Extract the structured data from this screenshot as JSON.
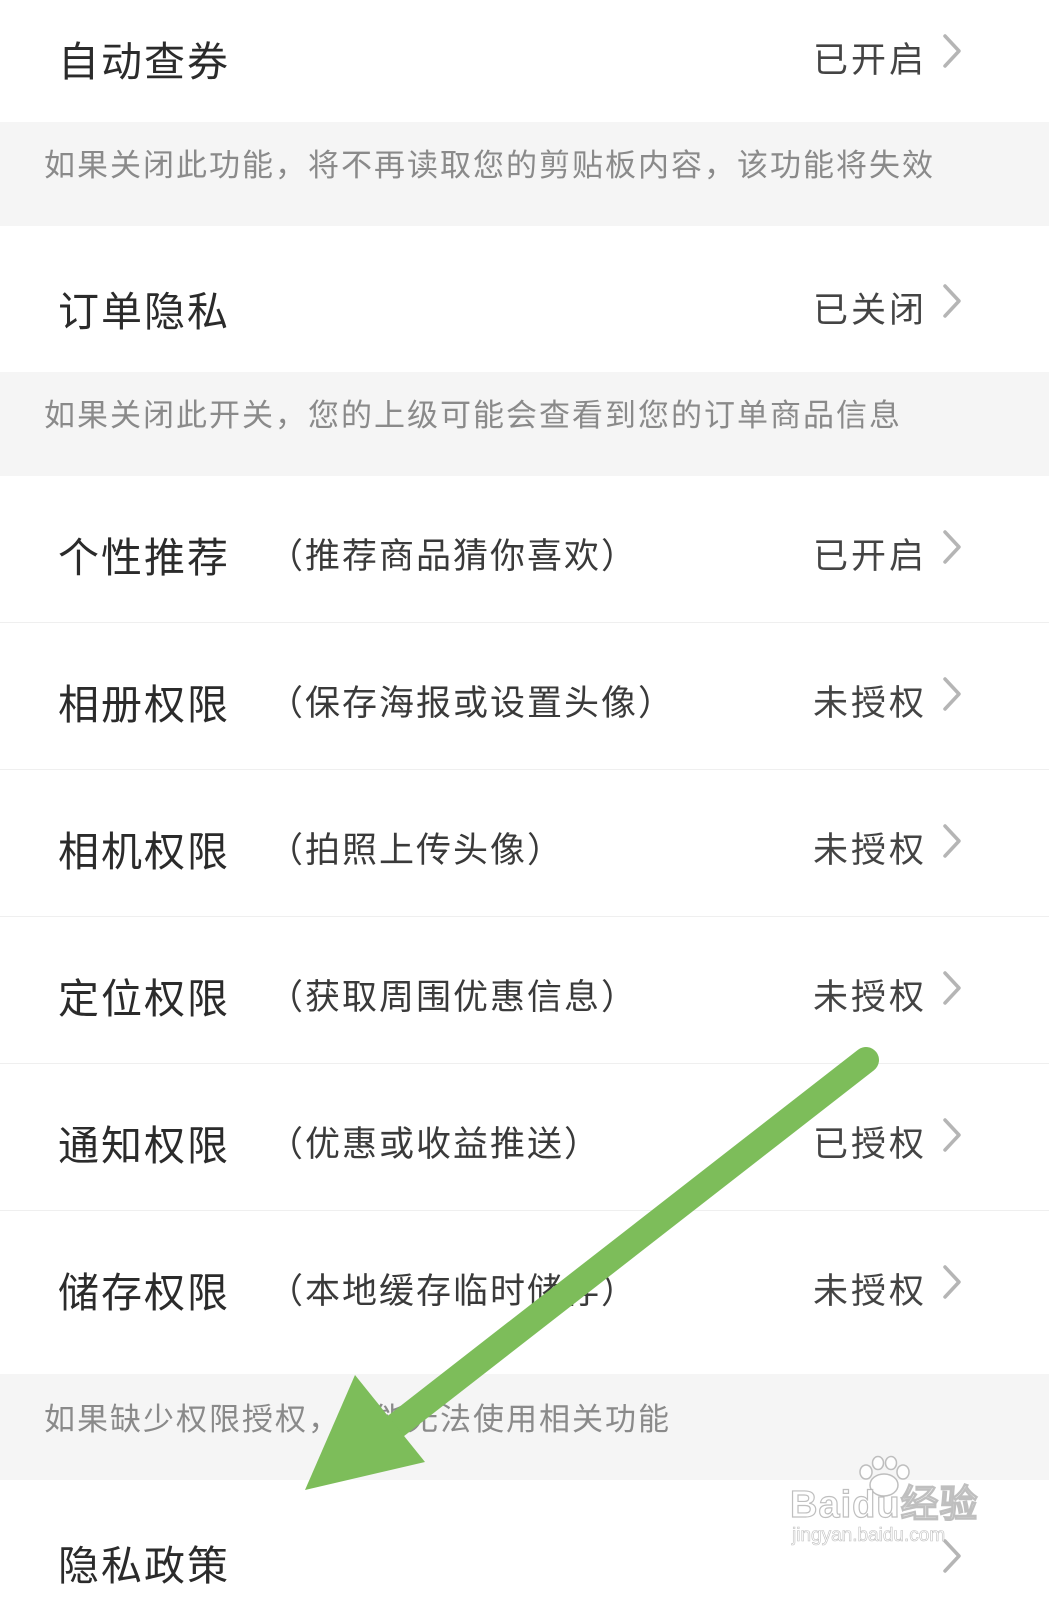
{
  "settings": {
    "auto_coupon": {
      "title": "自动查券",
      "status": "已开启"
    },
    "auto_coupon_note": "如果关闭此功能，将不再读取您的剪贴板内容，该功能将失效",
    "order_privacy": {
      "title": "订单隐私",
      "status": "已关闭"
    },
    "order_privacy_note": "如果关闭此开关，您的上级可能会查看到您的订单商品信息",
    "permissions": [
      {
        "title": "个性推荐",
        "hint": "（推荐商品猜你喜欢）",
        "status": "已开启"
      },
      {
        "title": "相册权限",
        "hint": "（保存海报或设置头像）",
        "status": "未授权"
      },
      {
        "title": "相机权限",
        "hint": "（拍照上传头像）",
        "status": "未授权"
      },
      {
        "title": "定位权限",
        "hint": "（获取周围优惠信息）",
        "status": "未授权"
      },
      {
        "title": "通知权限",
        "hint": "（优惠或收益推送）",
        "status": "已授权"
      },
      {
        "title": "储存权限",
        "hint": "（本地缓存临时储存）",
        "status": "未授权"
      }
    ],
    "permissions_note": "如果缺少权限授权，可能无法使用相关功能",
    "privacy_policy": {
      "title": "隐私政策"
    }
  },
  "overlay": {
    "arrow_color": "#7dbd5a",
    "watermark": {
      "brand": "Baidu经验",
      "url": "jingyan.baidu.com"
    }
  },
  "colors": {
    "note_background": "#f5f5f5",
    "chevron": "#b5b5b5"
  }
}
